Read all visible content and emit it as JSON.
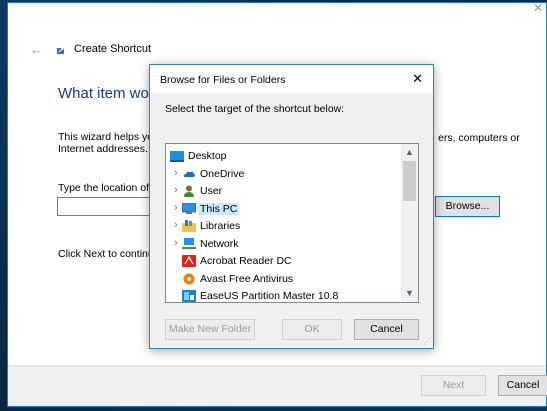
{
  "wizard": {
    "title": "Create Shortcut",
    "heading": "What item woul",
    "description_line1": "This wizard helps yo",
    "description_line2": "Internet addresses.",
    "description_right": "ers, computers or",
    "location_label": "Type the location of",
    "location_value": "",
    "browse_label": "Browse...",
    "click_next_text": "Click Next to continu",
    "next_label": "Next",
    "cancel_label": "Cancel"
  },
  "dialog": {
    "title": "Browse for Files or Folders",
    "instruction": "Select the target of the shortcut below:",
    "tree": [
      {
        "label": "Desktop",
        "icon": "desktop-icon",
        "level": 0,
        "expandable": false,
        "selected": false
      },
      {
        "label": "OneDrive",
        "icon": "onedrive-icon",
        "level": 1,
        "expandable": true,
        "selected": false
      },
      {
        "label": "User",
        "icon": "user-icon",
        "level": 1,
        "expandable": true,
        "selected": false
      },
      {
        "label": "This PC",
        "icon": "this-pc-icon",
        "level": 1,
        "expandable": true,
        "selected": true
      },
      {
        "label": "Libraries",
        "icon": "libraries-icon",
        "level": 1,
        "expandable": true,
        "selected": false
      },
      {
        "label": "Network",
        "icon": "network-icon",
        "level": 1,
        "expandable": true,
        "selected": false
      },
      {
        "label": "Acrobat Reader DC",
        "icon": "acrobat-icon",
        "level": 1,
        "expandable": false,
        "selected": false
      },
      {
        "label": "Avast Free Antivirus",
        "icon": "avast-icon",
        "level": 1,
        "expandable": false,
        "selected": false
      },
      {
        "label": "EaseUS Partition Master 10.8",
        "icon": "easeus-icon",
        "level": 1,
        "expandable": false,
        "selected": false
      }
    ],
    "make_new_folder_label": "Make New Folder",
    "ok_label": "OK",
    "cancel_label": "Cancel"
  },
  "colors": {
    "heading": "#1a3b8c",
    "selection": "#cce8ff",
    "accent": "#0078d7"
  }
}
